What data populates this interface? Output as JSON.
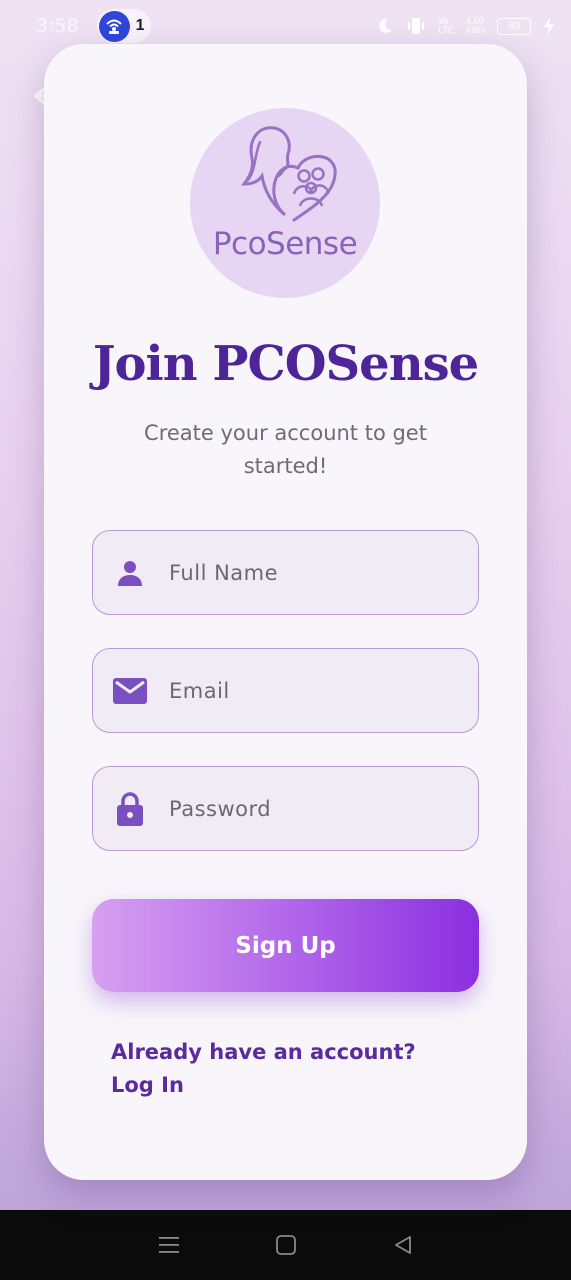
{
  "status_bar": {
    "time": "3:58",
    "hotspot_count": "1",
    "battery": "30",
    "icons": [
      "moon-icon",
      "vibrate-icon",
      "signal-icon",
      "battery-icon",
      "charging-icon"
    ],
    "network_small": [
      "Yo",
      "LTE"
    ],
    "speed_small": [
      "4.50",
      "KB/s"
    ]
  },
  "app": {
    "logo_text": "PcoSense",
    "title": "Join PCOSense",
    "subtitle": "Create your account to get started!",
    "colors": {
      "primary": "#4d2597",
      "accent": "#8a2fe0",
      "field_border": "#b79ad6",
      "icon": "#7a50c0"
    }
  },
  "form": {
    "full_name": {
      "placeholder": "Full Name",
      "value": "",
      "icon": "person-icon"
    },
    "email": {
      "placeholder": "Email",
      "value": "",
      "icon": "envelope-icon"
    },
    "password": {
      "placeholder": "Password",
      "value": "",
      "icon": "lock-icon"
    },
    "submit_label": "Sign Up"
  },
  "footer": {
    "login_text": "Already have an account? Log In"
  },
  "nav": {
    "icons": [
      "menu-icon",
      "home-icon",
      "back-icon"
    ]
  }
}
